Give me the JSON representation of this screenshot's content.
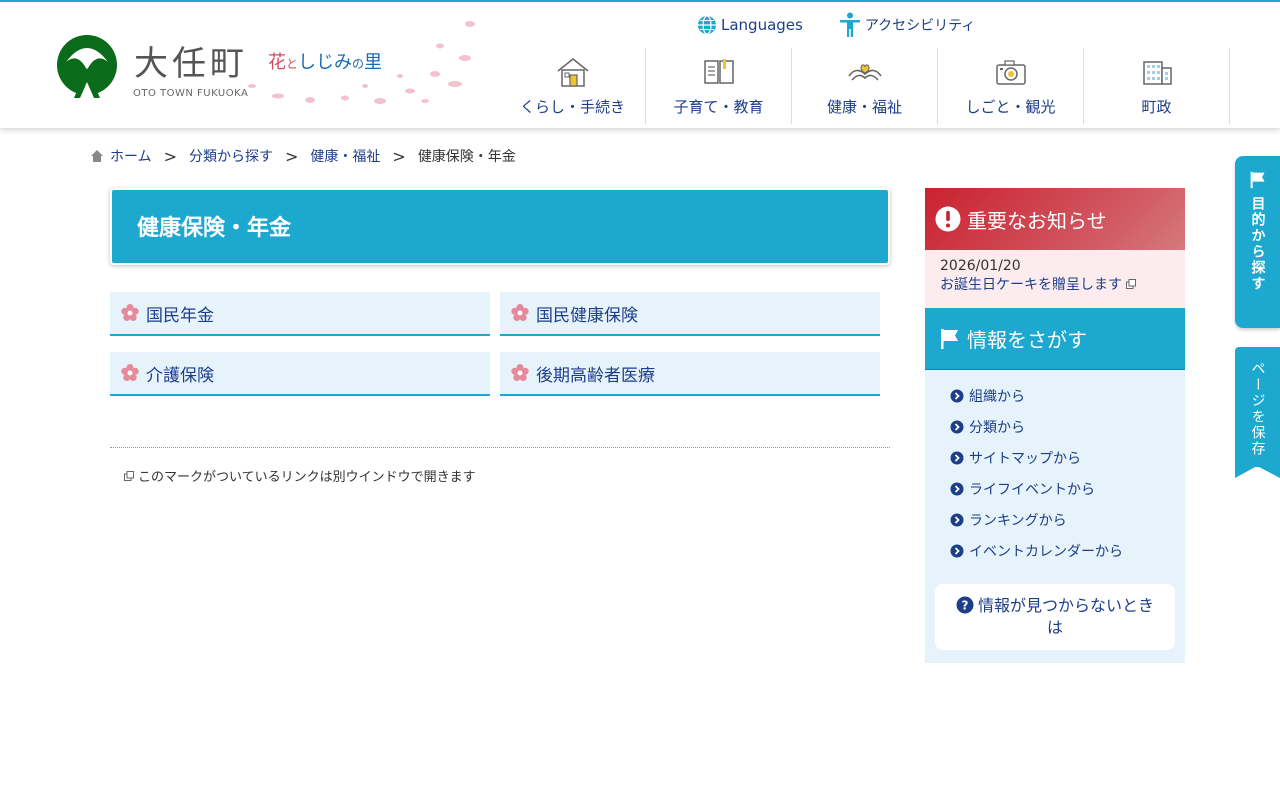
{
  "header": {
    "logo_text": "大任町",
    "logo_sub": "OTO TOWN FUKUOKA",
    "tagline_red": "花",
    "tagline_small": "と",
    "tagline_rest": "しじみ",
    "tagline_no": "の",
    "tagline_end": "里",
    "languages_label": "Languages",
    "accessibility_label": "アクセシビリティ",
    "nav": [
      {
        "label": "くらし・手続き",
        "icon": "house-icon"
      },
      {
        "label": "子育て・教育",
        "icon": "book-icon"
      },
      {
        "label": "健康・福祉",
        "icon": "hands-icon"
      },
      {
        "label": "しごと・観光",
        "icon": "camera-icon"
      },
      {
        "label": "町政",
        "icon": "building-icon"
      }
    ]
  },
  "breadcrumb": {
    "home": "ホーム",
    "level1": "分類から探す",
    "level2": "健康・福祉",
    "current": "健康保険・年金"
  },
  "main": {
    "title": "健康保険・年金",
    "categories": [
      {
        "label": "国民年金"
      },
      {
        "label": "国民健康保険"
      },
      {
        "label": "介護保険"
      },
      {
        "label": "後期高齢者医療"
      }
    ],
    "note": "このマークがついているリンクは別ウインドウで開きます"
  },
  "sidebar": {
    "notice_title": "重要なお知らせ",
    "notice_date": "2026/01/20",
    "notice_link": "お誕生日ケーキを贈呈します",
    "info_title": "情報をさがす",
    "info_links": [
      "組織から",
      "分類から",
      "サイトマップから",
      "ライフイベントから",
      "ランキングから",
      "イベントカレンダーから"
    ],
    "notfound_label": "情報が見つからないときは"
  },
  "tabs": {
    "purpose": "目的から探す",
    "save": "ページを保存"
  },
  "colors": {
    "accent": "#1ca8cf",
    "nav_text": "#1d3e8a",
    "notice_red": "#c9222f",
    "light_blue_bg": "#e6f3fb",
    "logo_green": "#0a6b1a"
  }
}
